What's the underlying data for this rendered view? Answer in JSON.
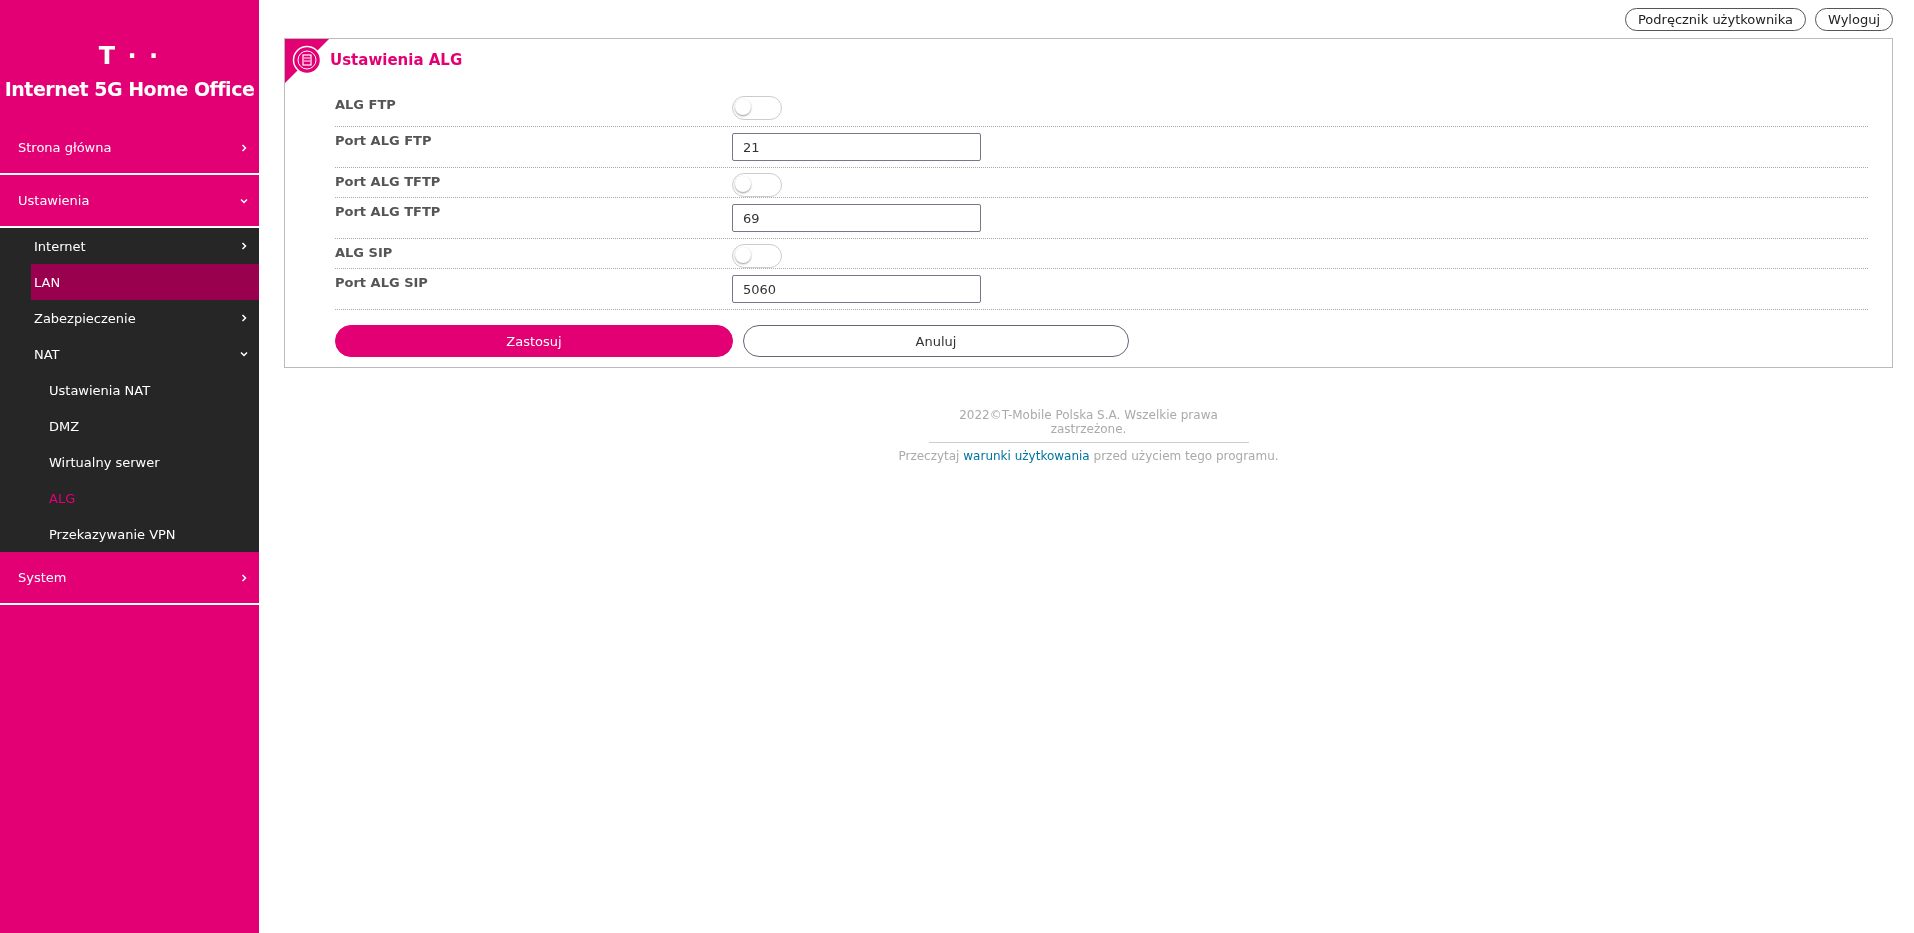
{
  "brand": {
    "logo": "T · ·",
    "title": "Internet 5G Home Office"
  },
  "sidebar": {
    "items": [
      {
        "label": "Strona główna",
        "expanded": false,
        "selected": false,
        "hovered": false
      },
      {
        "label": "Ustawienia",
        "expanded": true,
        "selected": false,
        "hovered": false,
        "children": [
          {
            "label": "Internet",
            "expanded": false,
            "selected": false,
            "hovered": false
          },
          {
            "label": "LAN",
            "selected": false,
            "hovered": true
          },
          {
            "label": "Zabezpieczenie",
            "expanded": false,
            "selected": false,
            "hovered": false
          },
          {
            "label": "NAT",
            "expanded": true,
            "selected": false,
            "hovered": false,
            "children": [
              {
                "label": "Ustawienia NAT",
                "selected": false,
                "hovered": false
              },
              {
                "label": "DMZ",
                "selected": false,
                "hovered": false
              },
              {
                "label": "Wirtualny serwer",
                "selected": false,
                "hovered": false
              },
              {
                "label": "ALG",
                "selected": true,
                "hovered": false
              },
              {
                "label": "Przekazywanie VPN",
                "selected": false,
                "hovered": false
              }
            ]
          }
        ]
      },
      {
        "label": "System",
        "expanded": false,
        "selected": false,
        "hovered": false
      }
    ]
  },
  "top_links": [
    "Podręcznik użytkownika",
    "Wyloguj"
  ],
  "panel": {
    "title": "Ustawienia ALG",
    "rows": [
      {
        "kind": "toggle",
        "label": "ALG FTP",
        "on": false
      },
      {
        "kind": "input",
        "label": "Port ALG FTP",
        "value": "21"
      },
      {
        "kind": "toggle",
        "label": "Port ALG TFTP",
        "on": false
      },
      {
        "kind": "input",
        "label": "Port ALG TFTP",
        "value": "69"
      },
      {
        "kind": "toggle",
        "label": "ALG SIP",
        "on": false
      },
      {
        "kind": "input",
        "label": "Port ALG SIP",
        "value": "5060"
      }
    ],
    "buttons": [
      {
        "label": "Zastosuj",
        "primary": true
      },
      {
        "label": "Anuluj",
        "primary": false
      }
    ]
  },
  "footer": {
    "copyright": "2022©T-Mobile Polska S.A. Wszelkie prawa zastrzeżone.",
    "before": "Przeczytaj",
    "link": "warunki użytkowania",
    "after": "przed użyciem tego programu."
  }
}
